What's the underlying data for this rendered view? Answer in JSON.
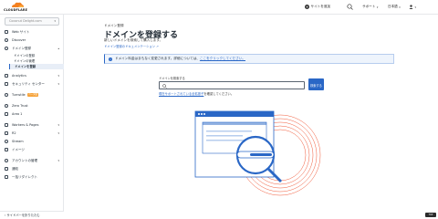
{
  "topbar": {
    "logo_text": "CLOUDFLARE",
    "add_site": "サイトを追加",
    "support": "サポート",
    "language": "日本語"
  },
  "sidebar": {
    "account_name": "Coconut Delight.com",
    "items": [
      {
        "label": "Web サイト",
        "icon": "globe-icon"
      },
      {
        "label": "Discover",
        "icon": "compass-icon"
      },
      {
        "label": "ドメイン登録",
        "icon": "globe-register-icon"
      },
      {
        "label": "Analytics",
        "icon": "analytics-icon"
      },
      {
        "label": "セキュリティ センター",
        "icon": "shield-icon"
      },
      {
        "label": "Turnstile",
        "icon": "turnstile-icon",
        "badge": "ベータ版"
      },
      {
        "label": "Zero Trust",
        "icon": "zero-trust-icon"
      },
      {
        "label": "Area 1",
        "icon": "email-security-icon"
      },
      {
        "label": "Workers & Pages",
        "icon": "workers-icon"
      },
      {
        "label": "R2",
        "icon": "storage-icon"
      },
      {
        "label": "Stream",
        "icon": "stream-icon"
      },
      {
        "label": "イメージ",
        "icon": "image-icon"
      },
      {
        "label": "アカウントの管理",
        "icon": "account-icon"
      },
      {
        "label": "通知",
        "icon": "bell-icon"
      },
      {
        "label": "一括リダイレクト",
        "icon": "redirect-icon"
      }
    ],
    "sub_items": [
      "ドメインの登録",
      "ドメインの管理",
      "ドメインを登録"
    ],
    "collapse_label": "サイドバーを折りたたむ"
  },
  "main": {
    "breadcrumb": "ドメイン登録",
    "title": "ドメインを登録する",
    "subtitle": "新しいドメインを検索して購入します。",
    "doc_link": "ドメイン登録のドキュメンテーション",
    "banner_text": "ドメイン料金はまもなく変更されます。詳細については、",
    "banner_link": "ここをクリックしてください。",
    "search_label": "ドメインを検索する",
    "search_placeholder": "",
    "search_button": "検索する",
    "supported_link": "現在サポートされている全拡張子",
    "supported_text": "を確認してください。"
  },
  "corner_badge": "TOP"
}
